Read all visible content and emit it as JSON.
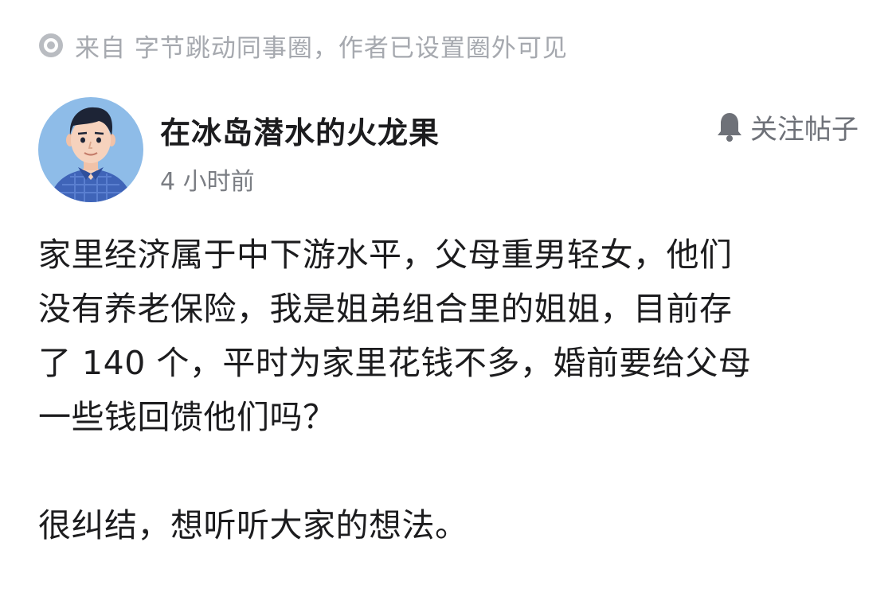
{
  "source": {
    "text": "来自 字节跳动同事圈，作者已设置圈外可见",
    "icon": "circle-dot-icon"
  },
  "author": {
    "name": "在冰岛潜水的火龙果",
    "time": "4 小时前",
    "avatar_icon": "avatar-illustration"
  },
  "follow": {
    "label": "关注帖子",
    "icon": "bell-icon"
  },
  "post": {
    "paragraph1_lines": [
      "家里经济属于中下游水平，父母重男轻女，他们",
      "没有养老保险，我是姐弟组合里的姐姐，目前存",
      "了 140 个，平时为家里花钱不多，婚前要给父母",
      "一些钱回馈他们吗？"
    ],
    "paragraph2": "很纠结，想听听大家的想法。"
  },
  "colors": {
    "muted": "#a6a9af",
    "text": "#1c1c1e",
    "avatar_bg": "#8ebce8",
    "shirt": "#3f64b8"
  }
}
